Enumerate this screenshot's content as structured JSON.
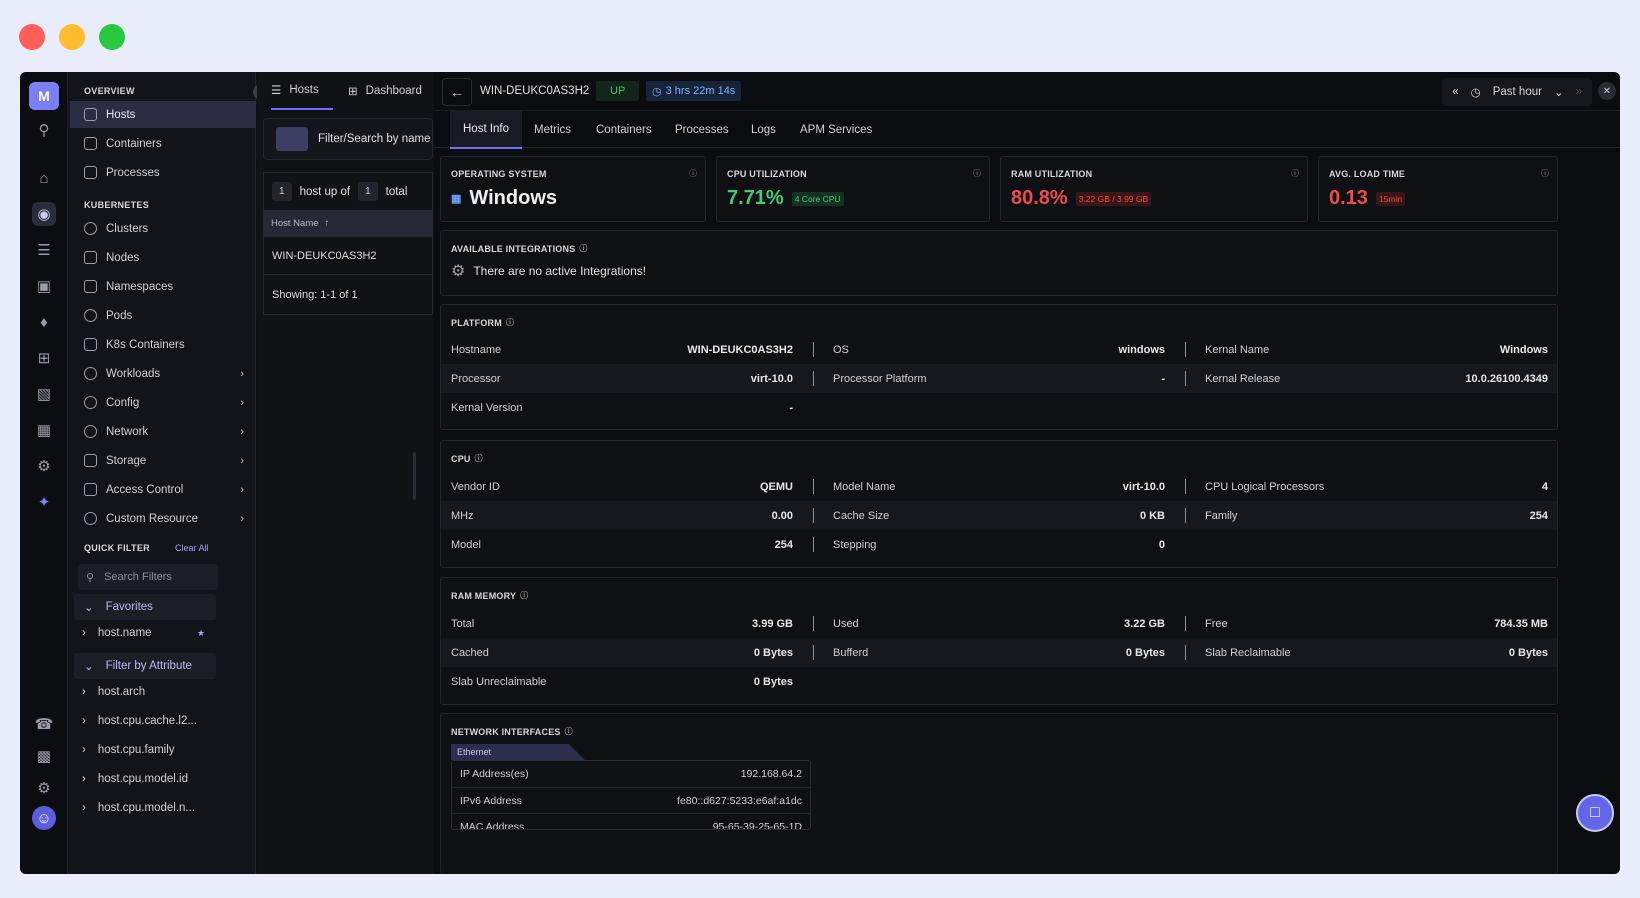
{
  "window": {
    "dots": [
      "#ff5f57",
      "#febc2e",
      "#28c840"
    ]
  },
  "rail": {
    "logo": "M"
  },
  "sidebar": {
    "overview_label": "OVERVIEW",
    "overview_items": [
      "Hosts",
      "Containers",
      "Processes"
    ],
    "kubernetes_label": "KUBERNETES",
    "k8s_items": [
      "Clusters",
      "Nodes",
      "Namespaces",
      "Pods",
      "K8s Containers",
      "Workloads",
      "Config",
      "Network",
      "Storage",
      "Access Control",
      "Custom Resource"
    ],
    "quick_filter_label": "QUICK FILTER",
    "clear_all": "Clear All",
    "search_placeholder": "Search Filters",
    "favorites": "Favorites",
    "fav_items": [
      "host.name"
    ],
    "filter_by_attribute": "Filter by Attribute",
    "attr_items": [
      "host.arch",
      "host.cpu.cache.l2...",
      "host.cpu.family",
      "host.cpu.model.id",
      "host.cpu.model.n..."
    ]
  },
  "hosts_panel": {
    "tab_hosts": "Hosts",
    "tab_dashboard": "Dashboard",
    "filter_placeholder": "Filter/Search by name",
    "count_a": "1",
    "count_text": "host up of",
    "count_b": "1",
    "count_total": "total",
    "column": "Host Name",
    "row": "WIN-DEUKC0AS3H2",
    "showing": "Showing: 1-1 of 1"
  },
  "detail": {
    "hostname": "WIN-DEUKC0AS3H2",
    "status": "UP",
    "uptime": "3 hrs 22m 14s",
    "time_range": "Past hour",
    "tabs": [
      "Host Info",
      "Metrics",
      "Containers",
      "Processes",
      "Logs",
      "APM Services"
    ],
    "os_card": {
      "title": "OPERATING SYSTEM",
      "value": "Windows"
    },
    "cpu_card": {
      "title": "CPU UTILIZATION",
      "value": "7.71%",
      "sub": "4 Core CPU"
    },
    "ram_card": {
      "title": "RAM UTILIZATION",
      "value": "80.8%",
      "sub": "3.22 GB / 3.99 GB"
    },
    "load_card": {
      "title": "AVG. LOAD TIME",
      "value": "0.13",
      "sub": "15min"
    },
    "integrations": {
      "title": "AVAILABLE INTEGRATIONS",
      "message": "There are no active Integrations!"
    },
    "platform": {
      "title": "PLATFORM",
      "rows": [
        [
          [
            "Hostname",
            "WIN-DEUKC0AS3H2"
          ],
          [
            "OS",
            "windows"
          ],
          [
            "Kernal Name",
            "Windows"
          ]
        ],
        [
          [
            "Processor",
            "virt-10.0"
          ],
          [
            "Processor Platform",
            "-"
          ],
          [
            "Kernal Release",
            "10.0.26100.4349"
          ]
        ],
        [
          [
            "Kernal Version",
            "-"
          ]
        ]
      ]
    },
    "cpu": {
      "title": "CPU",
      "rows": [
        [
          [
            "Vendor ID",
            "QEMU"
          ],
          [
            "Model Name",
            "virt-10.0"
          ],
          [
            "CPU Logical Processors",
            "4"
          ]
        ],
        [
          [
            "MHz",
            "0.00"
          ],
          [
            "Cache Size",
            "0 KB"
          ],
          [
            "Family",
            "254"
          ]
        ],
        [
          [
            "Model",
            "254"
          ],
          [
            "Stepping",
            "0"
          ]
        ]
      ]
    },
    "ram": {
      "title": "RAM MEMORY",
      "rows": [
        [
          [
            "Total",
            "3.99 GB"
          ],
          [
            "Used",
            "3.22 GB"
          ],
          [
            "Free",
            "784.35 MB"
          ]
        ],
        [
          [
            "Cached",
            "0 Bytes"
          ],
          [
            "Bufferd",
            "0 Bytes"
          ],
          [
            "Slab Reclaimable",
            "0 Bytes"
          ]
        ],
        [
          [
            "Slab Unreclaimable",
            "0 Bytes"
          ]
        ]
      ]
    },
    "network": {
      "title": "NETWORK INTERFACES",
      "tab": "Ethernet",
      "rows": [
        [
          "IP Address(es)",
          "192.168.64.2"
        ],
        [
          "IPv6 Address",
          "fe80::d627:5233:e6af:a1dc"
        ],
        [
          "MAC Address",
          "95-65-39-25-65-1D"
        ]
      ]
    }
  }
}
